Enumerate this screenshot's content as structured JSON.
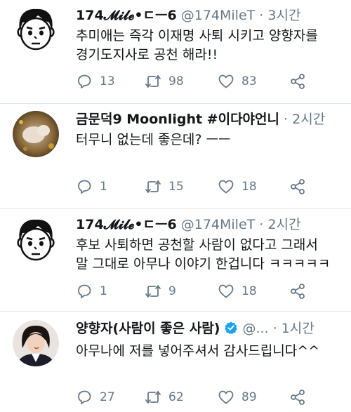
{
  "tweets": [
    {
      "name": "174𝓜𝓲𝓵𝓮•ㄷㅡ6",
      "handle": "@174MileT",
      "dot": "·",
      "time": "3시간",
      "lines": [
        "추미애는 즉각 이재명 사퇴 시키고 양향자를",
        "경기도지사로 공천 해라!!"
      ],
      "replies": "13",
      "retweets": "98",
      "likes": "83",
      "avatar": "cartoon-face"
    },
    {
      "name": "금문덕9 Moonlight #이다야언니",
      "handle": "",
      "dot": "·",
      "time": "2시간",
      "lines": [
        "터무니 없는데 좋은데? ㅡㅡ"
      ],
      "replies": "1",
      "retweets": "15",
      "likes": "18",
      "avatar": "photo-cat"
    },
    {
      "name": "174𝓜𝓲𝓵𝓮•ㄷㅡ6",
      "handle": "@174MileT",
      "dot": "·",
      "time": "2시간",
      "lines": [
        "후보 사퇴하면 공천할 사람이 없다고 그래서",
        "말 그대로 아무나 이야기 한겁니다 ㅋㅋㅋㅋㅋ"
      ],
      "replies": "1",
      "retweets": "9",
      "likes": "18",
      "avatar": "cartoon-face"
    },
    {
      "name": "양향자(사람이 좋은 사람)",
      "handle": "@...",
      "dot": "·",
      "time": "1시간",
      "lines": [
        "아무나에 저를 넣어주셔서 감사드립니다^^"
      ],
      "replies": "27",
      "retweets": "62",
      "likes": "89",
      "avatar": "photo-woman",
      "verified": true
    }
  ],
  "colors": {
    "text": "#14171a",
    "secondary": "#657786",
    "divider": "#e1e8ed",
    "verified": "#1da1f2"
  },
  "icons": [
    "reply-icon",
    "retweet-icon",
    "like-icon",
    "share-icon",
    "verified-badge-icon"
  ]
}
